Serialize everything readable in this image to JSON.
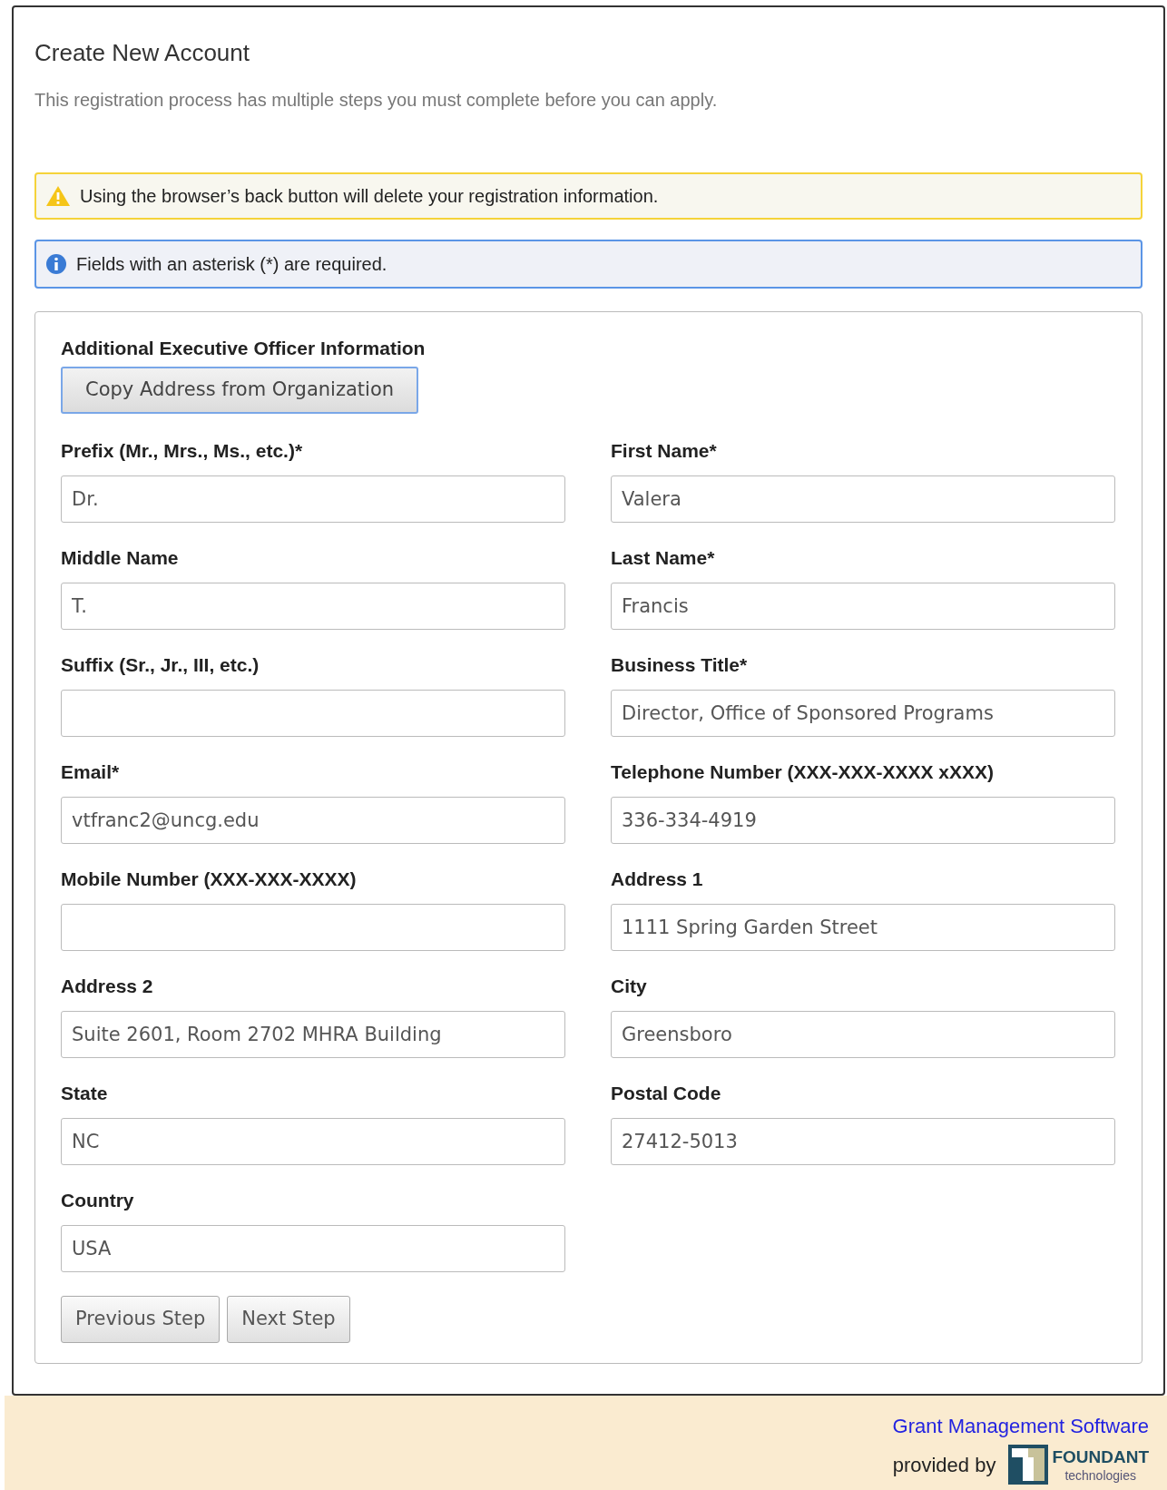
{
  "page": {
    "title": "Create New Account",
    "intro": "This registration process has multiple steps you must complete before you can apply."
  },
  "alerts": [
    {
      "kind": "warning",
      "text": "Using the browser’s back button will delete your registration information."
    },
    {
      "kind": "info",
      "text": "Fields with an asterisk (*) are required."
    }
  ],
  "section": {
    "heading": "Additional Executive Officer Information",
    "copy_button": "Copy Address from Organization"
  },
  "fields": [
    {
      "label": "Prefix (Mr., Mrs., Ms., etc.)*",
      "value": "Dr."
    },
    {
      "label": "First Name*",
      "value": "Valera"
    },
    {
      "label": "Middle Name",
      "value": "T."
    },
    {
      "label": "Last Name*",
      "value": "Francis"
    },
    {
      "label": "Suffix (Sr., Jr., III, etc.)"
    },
    {
      "label": "Business Title*",
      "value": "Director, Office of Sponsored Programs"
    },
    {
      "label": "Email*",
      "value": "vtfranc2@uncg.edu"
    },
    {
      "label": "Telephone Number (XXX-XXX-XXXX xXXX)",
      "value": "336-334-4919"
    },
    {
      "label": "Mobile Number (XXX-XXX-XXXX)"
    },
    {
      "label": "Address 1",
      "value": "1111 Spring Garden Street"
    },
    {
      "label": "Address 2",
      "value": "Suite 2601, Room 2702 MHRA Building"
    },
    {
      "label": "City",
      "value": "Greensboro"
    },
    {
      "label": "State",
      "value": "NC"
    },
    {
      "label": "Postal Code",
      "value": "27412-5013"
    },
    {
      "label": "Country",
      "value": "USA"
    }
  ],
  "buttons": [
    "Previous Step",
    "Next Step"
  ],
  "footer": {
    "link": "Grant Management Software",
    "provided_by": "provided by",
    "logo_name": "FOUNDANT",
    "logo_tagline": "technologies"
  }
}
